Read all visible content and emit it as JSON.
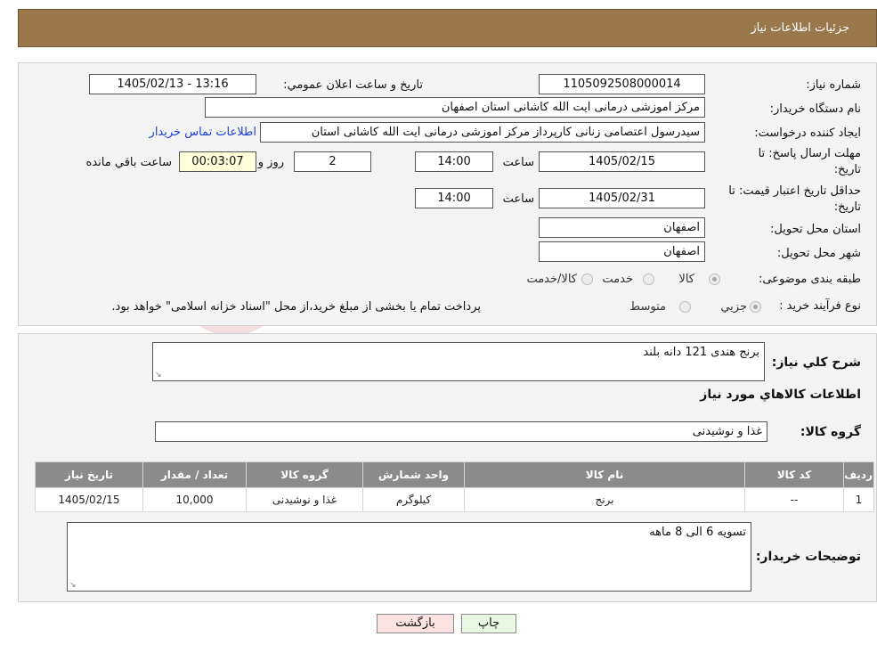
{
  "header": {
    "title": "جزئیات اطلاعات نیاز"
  },
  "watermark": {
    "text": "AriaTender.neT"
  },
  "form": {
    "need_number_label": "شماره نیاز:",
    "need_number": "1105092508000014",
    "announce_label": "تاریخ و ساعت اعلان عمومي:",
    "announce_value": "1405/02/13 - 13:16",
    "buyer_org_label": "نام دستگاه خريدار:",
    "buyer_org": "مرکز اموزشی درمانی ایت الله کاشانی استان اصفهان",
    "creator_label": "ايجاد کننده درخواست:",
    "creator": "سیدرسول اعتصامی زنانی کارپرداز مرکز اموزشی درمانی ایت الله کاشانی استان",
    "contact_link": "اطلاعات تماس خريدار",
    "deadline_label": "مهلت ارسال پاسخ: تا",
    "deadline_label2": "تاريخ:",
    "deadline_date": "1405/02/15",
    "time_label": "ساعت",
    "deadline_time": "14:00",
    "days": "2",
    "days_label": "روز و",
    "remaining": "00:03:07",
    "remaining_label": "ساعت باقي مانده",
    "validity_label": "حداقل تاريخ اعتبار قيمت: تا",
    "validity_label2": "تاريخ:",
    "validity_date": "1405/02/31",
    "validity_time_label": "ساعت",
    "validity_time": "14:00",
    "province_label": "استان محل تحويل:",
    "province": "اصفهان",
    "city_label": "شهر محل تحويل:",
    "city": "اصفهان",
    "category_label": "طبقه بندی موضوعی:",
    "category_options": [
      "کالا",
      "خدمت",
      "کالا/خدمت"
    ],
    "process_label": "نوع فرآيند خريد :",
    "process_options": [
      "جزيي",
      "متوسط"
    ],
    "process_note": "پرداخت تمام يا بخشی از مبلغ خريد،از محل \"اسناد خزانه اسلامی\" خواهد بود."
  },
  "details": {
    "summary_label": "شرح کلي نياز:",
    "summary": "برنج هندی 121 دانه بلند",
    "goods_title": "اطلاعات کالاهاي مورد نياز",
    "group_label": "گروه کالا:",
    "group": "غذا و نوشیدنی",
    "table": {
      "headers": [
        "رديف",
        "کد کالا",
        "نام کالا",
        "واحد شمارش",
        "گروه کالا",
        "تعداد / مقدار",
        "تاريخ نياز"
      ],
      "rows": [
        [
          "1",
          "--",
          "برنج",
          "کیلوگرم",
          "غذا و نوشیدنی",
          "10,000",
          "1405/02/15"
        ]
      ]
    },
    "buyer_notes_label": "توضيحات خريدار:",
    "buyer_notes": "تسویه 6 الی 8 ماهه"
  },
  "buttons": {
    "print": "چاپ",
    "back": "بازگشت"
  }
}
